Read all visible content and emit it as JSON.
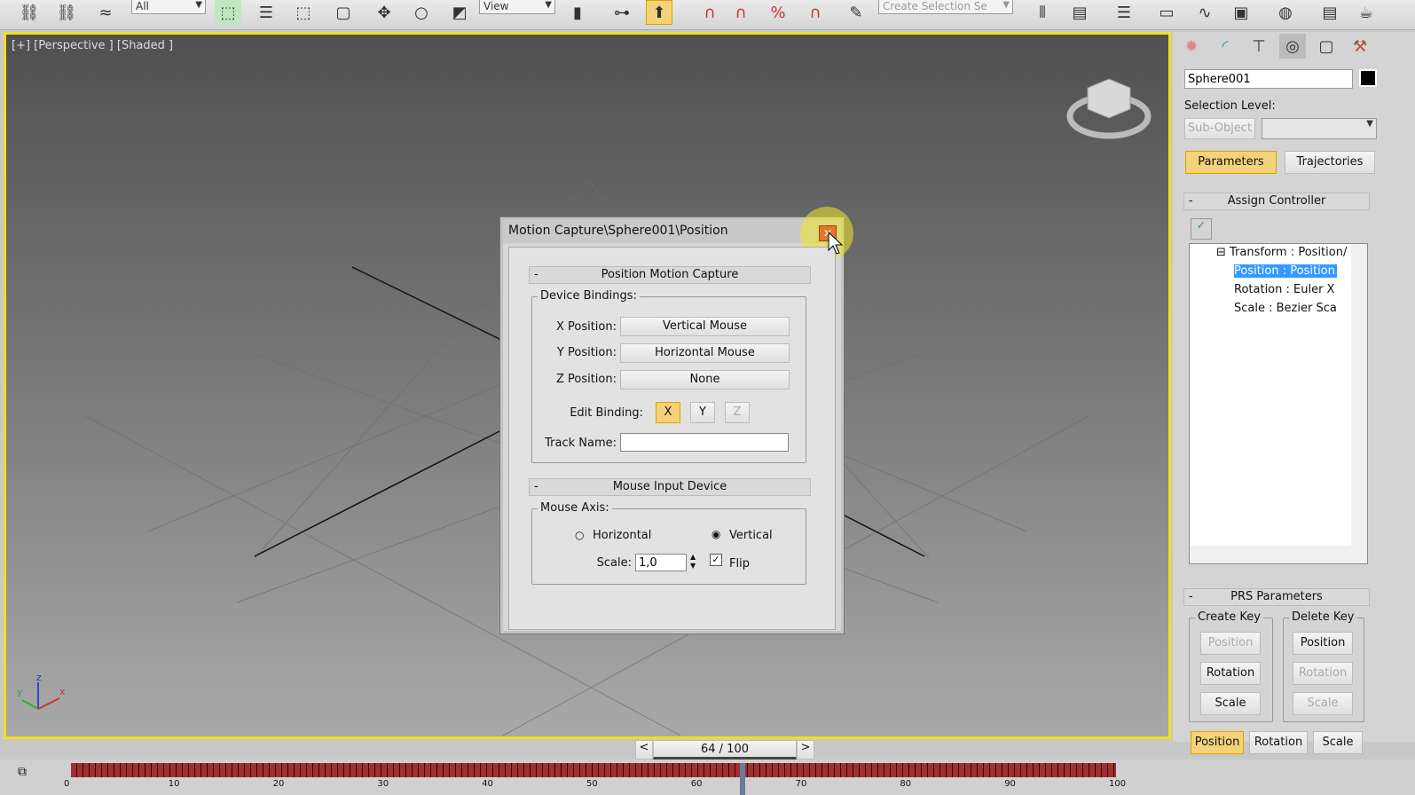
{
  "toolbar": {
    "selection_filter": "All",
    "reference_coord": "View",
    "named_selection_placeholder": "Create Selection Se"
  },
  "viewport": {
    "label": "[+] [Perspective ] [Shaded ]",
    "axis_x": "x",
    "axis_y": "y",
    "axis_z": "z"
  },
  "dialog": {
    "title": "Motion Capture\\Sphere001\\Position",
    "section1": "Position Motion Capture",
    "device_bindings": "Device Bindings:",
    "x_label": "X Position:",
    "x_value": "Vertical Mouse",
    "y_label": "Y Position:",
    "y_value": "Horizontal Mouse",
    "z_label": "Z Position:",
    "z_value": "None",
    "edit_binding": "Edit Binding:",
    "bx": "X",
    "by": "Y",
    "bz": "Z",
    "track_name": "Track Name:",
    "track_value": "",
    "section2": "Mouse Input Device",
    "mouse_axis": "Mouse Axis:",
    "horizontal": "Horizontal",
    "vertical": "Vertical",
    "scale": "Scale:",
    "scale_value": "1,0",
    "flip": "Flip",
    "collapse": "-"
  },
  "panel": {
    "object_name": "Sphere001",
    "selection_level": "Selection Level:",
    "sub_object": "Sub-Object",
    "tab_parameters": "Parameters",
    "tab_trajectories": "Trajectories",
    "assign_controller": "Assign Controller",
    "tree": [
      "Transform : Position/",
      "Position : Position",
      "Rotation : Euler X",
      "Scale : Bezier Sca"
    ],
    "prs": "PRS Parameters",
    "create_key": "Create Key",
    "delete_key": "Delete Key",
    "position": "Position",
    "rotation": "Rotation",
    "scale": "Scale"
  },
  "timeline": {
    "frame": "64 / 100",
    "prev": "<",
    "next": ">",
    "ticks": [
      "0",
      "10",
      "20",
      "30",
      "40",
      "50",
      "60",
      "70",
      "80",
      "90",
      "100"
    ],
    "current_frame": 64,
    "total_frames": 100
  }
}
